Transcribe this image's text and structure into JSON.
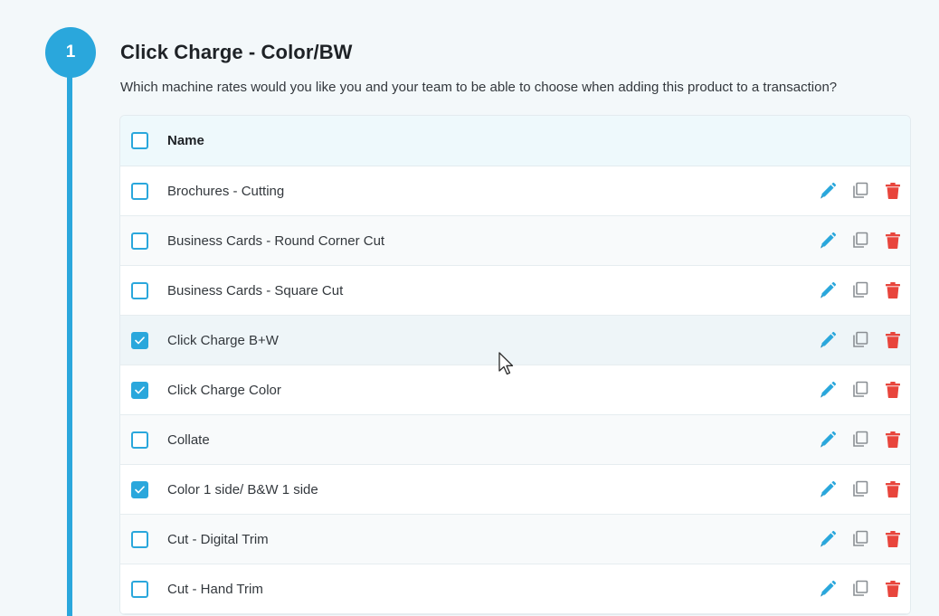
{
  "step": {
    "number": "1",
    "title": "Click Charge - Color/BW",
    "description": "Which machine rates would you like you and your team to be able to choose when adding this product to a transaction?"
  },
  "table": {
    "header": {
      "name_label": "Name",
      "select_all_checked": false
    },
    "rows": [
      {
        "name": "Brochures - Cutting",
        "checked": false
      },
      {
        "name": "Business Cards - Round Corner Cut",
        "checked": false
      },
      {
        "name": "Business Cards - Square Cut",
        "checked": false
      },
      {
        "name": "Click Charge B+W",
        "checked": true
      },
      {
        "name": "Click Charge Color",
        "checked": true
      },
      {
        "name": "Collate",
        "checked": false
      },
      {
        "name": "Color 1 side/ B&W 1 side",
        "checked": true
      },
      {
        "name": "Cut - Digital Trim",
        "checked": false
      },
      {
        "name": "Cut - Hand Trim",
        "checked": false
      }
    ],
    "row_actions": [
      "pencil-icon",
      "copy-icon",
      "trash-icon"
    ]
  },
  "colors": {
    "accent": "#2aa7dc",
    "delete": "#e8453c",
    "copy": "#8a8f94"
  }
}
